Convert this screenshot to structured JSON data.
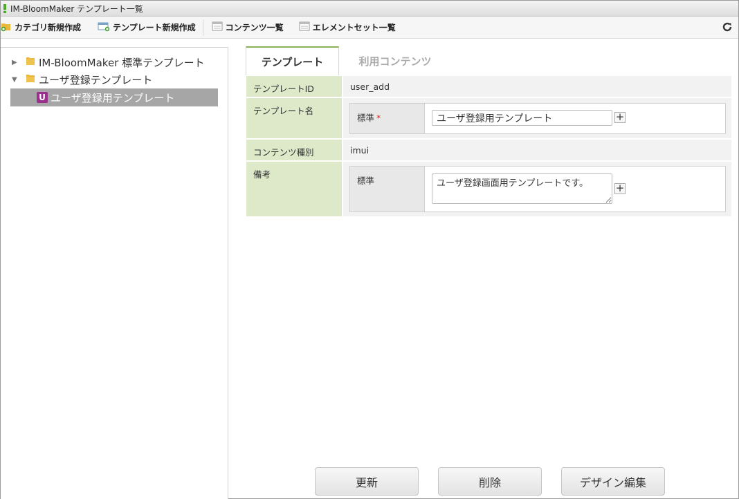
{
  "window": {
    "title": "IM-BloomMaker テンプレート一覧"
  },
  "toolbar": {
    "items": [
      {
        "label": "カテゴリ新規作成",
        "icon": "folder-add-icon"
      },
      {
        "label": "テンプレート新規作成",
        "icon": "template-add-icon"
      },
      {
        "label": "コンテンツ一覧",
        "icon": "list-icon"
      },
      {
        "label": "エレメントセット一覧",
        "icon": "list-icon"
      }
    ],
    "refresh_icon": "refresh-icon"
  },
  "tree": {
    "items": [
      {
        "label": "IM-BloomMaker 標準テンプレート",
        "expanded": false
      },
      {
        "label": "ユーザ登録テンプレート",
        "expanded": true
      },
      {
        "label": "ユーザ登録用テンプレート",
        "badge": "U",
        "selected": true
      }
    ]
  },
  "tabs": [
    {
      "label": "テンプレート",
      "active": true
    },
    {
      "label": "利用コンテンツ",
      "active": false
    }
  ],
  "form": {
    "template_id_label": "テンプレートID",
    "template_id_value": "user_add",
    "template_name_label": "テンプレート名",
    "template_name_sub_label": "標準",
    "template_name_required": "*",
    "template_name_value": "ユーザ登録用テンプレート",
    "content_type_label": "コンテンツ種別",
    "content_type_value": "imui",
    "notes_label": "備考",
    "notes_sub_label": "標準",
    "notes_value": "ユーザ登録画面用テンプレートです。"
  },
  "buttons": {
    "update": "更新",
    "delete": "削除",
    "design_edit": "デザイン編集"
  },
  "colors": {
    "label_bg": "#dde9c9",
    "tab_accent": "#89b35d",
    "selected_row": "#a6a6a6",
    "badge": "#9b2f8e"
  }
}
